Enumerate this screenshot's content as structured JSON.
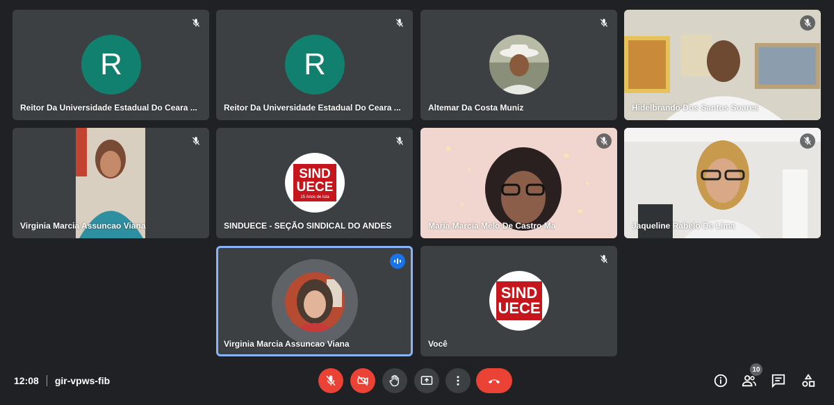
{
  "meeting": {
    "time": "12:08",
    "code": "gir-vpws-fib",
    "participant_count": "10"
  },
  "tiles": [
    {
      "name": "Reitor Da Universidade Estadual Do Ceara ...",
      "avatar_letter": "R"
    },
    {
      "name": "Reitor Da Universidade Estadual Do Ceara ...",
      "avatar_letter": "R"
    },
    {
      "name": "Altemar Da Costa Muniz"
    },
    {
      "name": "Hidelbrando Dos Santos Soares"
    },
    {
      "name": "Virginia Marcia Assuncao Viana"
    },
    {
      "name": "SINDUECE - SEÇÃO SINDICAL DO ANDES"
    },
    {
      "name": "Maria Marcia Melo De Castro Ma"
    },
    {
      "name": "Jaqueline Rabelo De Lima"
    },
    {
      "name": "Virginia Marcia Assuncao Viana"
    },
    {
      "name": "Você"
    }
  ],
  "logo": {
    "line1": "SIND",
    "line2": "UECE",
    "tagline": "15 Anos de luta"
  },
  "colors": {
    "background": "#202124",
    "tile": "#3c4043",
    "avatar": "#12806f",
    "danger": "#ea4335",
    "active_border": "#8ab4f8",
    "speaking": "#1a73e8"
  },
  "controls": [
    "mic-off-icon",
    "camera-off-icon",
    "raise-hand-icon",
    "present-icon",
    "more-options-icon",
    "end-call-icon"
  ],
  "side_controls": [
    "info-icon",
    "people-icon",
    "chat-icon",
    "activities-icon"
  ]
}
